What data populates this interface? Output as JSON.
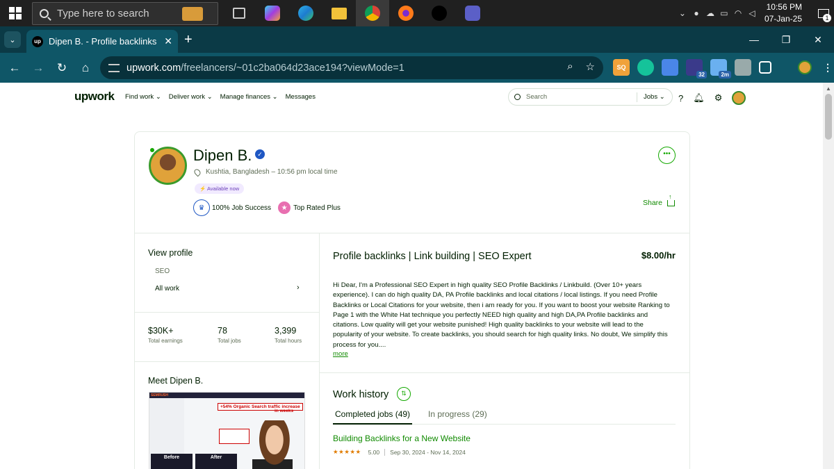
{
  "taskbar": {
    "search_placeholder": "Type here to search",
    "time": "10:56 PM",
    "date": "07-Jan-25",
    "notification_count": "1"
  },
  "browser": {
    "tab_title": "Dipen B. - Profile backlinks | Link building | SEO Expert",
    "tab_favicon_text": "up",
    "url_host": "upwork.com",
    "url_path": "/freelancers/~01c2ba064d23ace194?viewMode=1",
    "ext_badge_1": "32",
    "ext_badge_2": "2m",
    "ext_label_seo": "SQ"
  },
  "upwork": {
    "logo": "upwork",
    "nav": [
      "Find work",
      "Deliver work",
      "Manage finances",
      "Messages"
    ],
    "search_placeholder": "Search",
    "search_scope": "Jobs",
    "help_icon": "?"
  },
  "profile": {
    "name": "Dipen B.",
    "location": "Kushtia, Bangladesh – 10:56 pm local time",
    "availability": "Available now",
    "job_success": "100% Job Success",
    "badge": "Top Rated Plus",
    "share_label": "Share",
    "more_label": "•••"
  },
  "sidebar": {
    "view_profile_label": "View profile",
    "specialty": "SEO",
    "all_work": "All work",
    "stats": [
      {
        "value": "$30K+",
        "label": "Total earnings"
      },
      {
        "value": "78",
        "label": "Total jobs"
      },
      {
        "value": "3,399",
        "label": "Total hours"
      }
    ],
    "meet_label": "Meet Dipen B.",
    "video": {
      "brand": "SEMRUSH",
      "headline": "+54% Organic Search traffic increase",
      "weeks_text": "in weeks",
      "before": "Before",
      "after": "After"
    }
  },
  "main": {
    "title": "Profile backlinks | Link building | SEO Expert",
    "rate": "$8.00/hr",
    "bio": "Hi Dear, I'm a Professional SEO Expert in high quality SEO Profile Backlinks / Linkbuild. (Over 10+ years experience). I can do high quality DA, PA Profile backlinks and local citations / local listings. If you need Profile Backlinks or Local Citations for your website, then i am ready for you. If you want to boost your website Ranking to Page 1 with the White Hat technique you perfectly NEED high quality and high DA,PA Profile backlinks and citations. Low quality will get your website punished! High quality backlinks to your website will lead to the popularity of your website. To create backlinks, you should search for high quality links. No doubt, We simplify this process for you....",
    "more_link": "more",
    "work_history_title": "Work history",
    "tabs": [
      {
        "label": "Completed jobs (49)"
      },
      {
        "label": "In progress (29)"
      }
    ],
    "job": {
      "title": "Building Backlinks for a New Website",
      "stars": "★★★★★",
      "rating": "5.00",
      "dates": "Sep 30, 2024 - Nov 14, 2024"
    }
  }
}
